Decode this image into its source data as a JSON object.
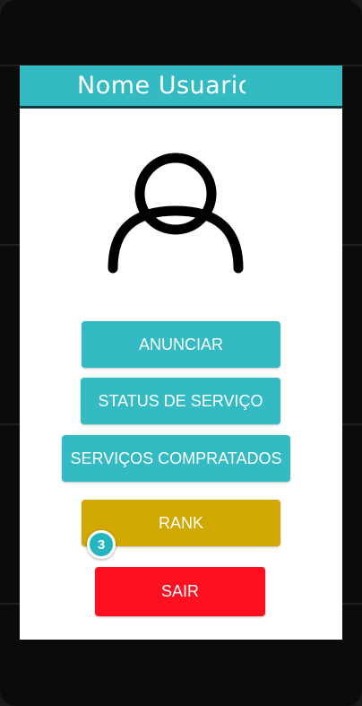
{
  "header": {
    "title": "Nome Usuario"
  },
  "avatar": {
    "icon": "user-profile-icon"
  },
  "menu": {
    "anunciar_label": "ANUNCIAR",
    "status_label": "STATUS DE SERVIÇO",
    "comprados_label": "SERVIÇOS COMPRATADOS",
    "rank_label": "RANK",
    "rank_badge": "3",
    "sair_label": "SAIR"
  },
  "colors": {
    "accent_teal": "#33bac2",
    "rank_gold": "#d1a800",
    "exit_red": "#ff1020"
  }
}
